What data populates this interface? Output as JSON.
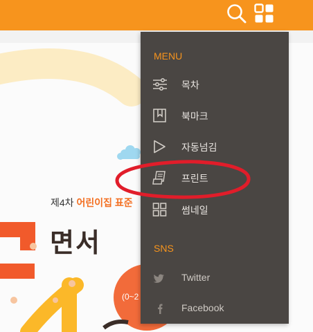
{
  "colors": {
    "accent": "#f7941d",
    "panel_bg": "#4a4643",
    "annotation": "#e11d2a"
  },
  "header": {
    "search_icon": "search-icon",
    "menu_icon": "grid-menu-icon"
  },
  "page": {
    "subtitle_prefix": "제4차 ",
    "subtitle_highlight": "어린이집 표준",
    "big_title": "면서",
    "age_text": "(0~2"
  },
  "menu": {
    "section_title": "MENU",
    "items": [
      {
        "label": "목차",
        "icon": "sliders-icon"
      },
      {
        "label": "북마크",
        "icon": "bookmark-icon"
      },
      {
        "label": "자동넘김",
        "icon": "play-icon"
      },
      {
        "label": "프린트",
        "icon": "print-icon"
      },
      {
        "label": "썸네일",
        "icon": "thumbnail-grid-icon"
      }
    ]
  },
  "sns": {
    "section_title": "SNS",
    "items": [
      {
        "label": "Twitter",
        "icon": "twitter-icon"
      },
      {
        "label": "Facebook",
        "icon": "facebook-icon"
      }
    ]
  }
}
